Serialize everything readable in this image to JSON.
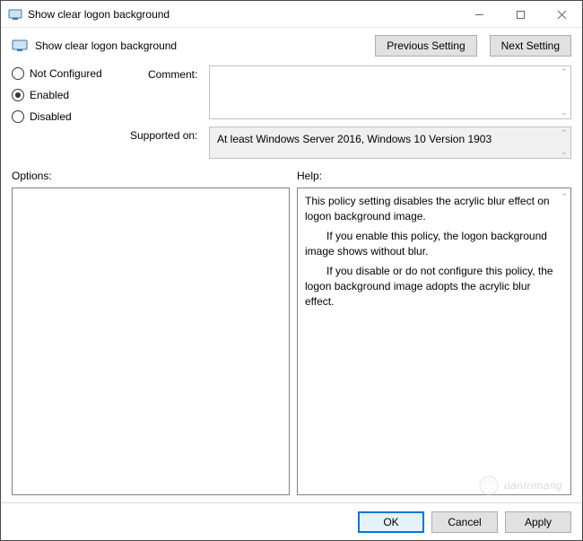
{
  "window": {
    "title": "Show clear logon background"
  },
  "header": {
    "setting_title": "Show clear logon background",
    "previous_label": "Previous Setting",
    "next_label": "Next Setting"
  },
  "radios": {
    "not_configured": "Not Configured",
    "enabled": "Enabled",
    "disabled": "Disabled",
    "selected": "enabled"
  },
  "fields": {
    "comment_label": "Comment:",
    "comment_value": "",
    "supported_label": "Supported on:",
    "supported_value": "At least Windows Server 2016, Windows 10 Version 1903"
  },
  "sections": {
    "options_label": "Options:",
    "help_label": "Help:"
  },
  "help": {
    "p1": "This policy setting disables the acrylic blur effect on logon background image.",
    "p2": "If you enable this policy, the logon background image shows without blur.",
    "p3": "If you disable or do not configure this policy, the logon background image adopts the acrylic blur effect."
  },
  "footer": {
    "ok": "OK",
    "cancel": "Cancel",
    "apply": "Apply"
  },
  "watermark": "uantrimang"
}
